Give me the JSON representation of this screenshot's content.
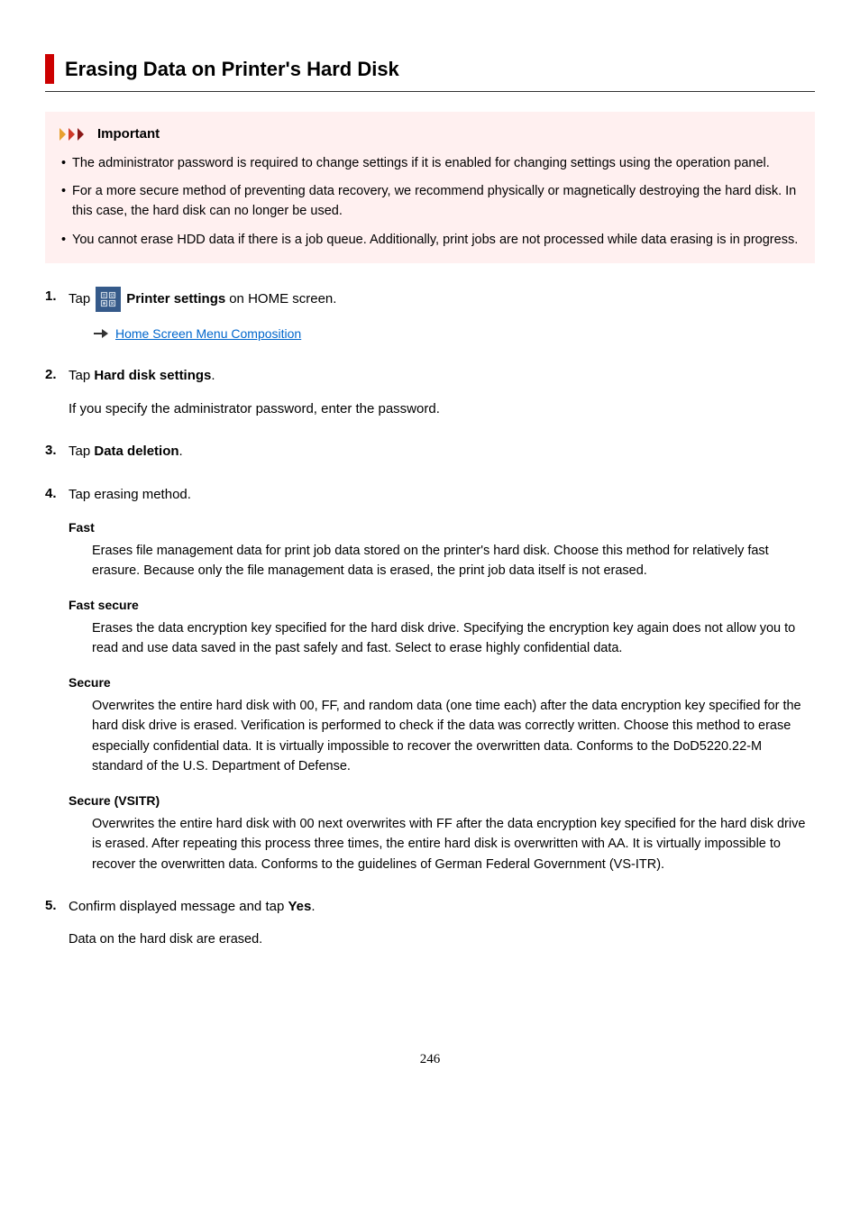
{
  "title": "Erasing Data on Printer's Hard Disk",
  "important": {
    "label": "Important",
    "items": [
      "The administrator password is required to change settings if it is enabled for changing settings using the operation panel.",
      "For a more secure method of preventing data recovery, we recommend physically or magnetically destroying the hard disk. In this case, the hard disk can no longer be used.",
      "You cannot erase HDD data if there is a job queue. Additionally, print jobs are not processed while data erasing is in progress."
    ]
  },
  "steps": {
    "s1": {
      "pre": "Tap",
      "bold": "Printer settings",
      "post": " on HOME screen.",
      "link_text": "Home Screen Menu Composition"
    },
    "s2": {
      "pre": "Tap ",
      "bold": "Hard disk settings",
      "post": ".",
      "note": "If you specify the administrator password, enter the password."
    },
    "s3": {
      "pre": "Tap ",
      "bold": "Data deletion",
      "post": "."
    },
    "s4": {
      "text": "Tap erasing method.",
      "methods": [
        {
          "name": "Fast",
          "desc": "Erases file management data for print job data stored on the printer's hard disk. Choose this method for relatively fast erasure. Because only the file management data is erased, the print job data itself is not erased."
        },
        {
          "name": "Fast secure",
          "desc": "Erases the data encryption key specified for the hard disk drive. Specifying the encryption key again does not allow you to read and use data saved in the past safely and fast. Select to erase highly confidential data."
        },
        {
          "name": "Secure",
          "desc": "Overwrites the entire hard disk with 00, FF, and random data (one time each) after the data encryption key specified for the hard disk drive is erased. Verification is performed to check if the data was correctly written. Choose this method to erase especially confidential data. It is virtually impossible to recover the overwritten data. Conforms to the DoD5220.22-M standard of the U.S. Department of Defense."
        },
        {
          "name": "Secure (VSITR)",
          "desc": "Overwrites the entire hard disk with 00 next overwrites with FF after the data encryption key specified for the hard disk drive is erased. After repeating this process three times, the entire hard disk is overwritten with AA. It is virtually impossible to recover the overwritten data. Conforms to the guidelines of German Federal Government (VS-ITR)."
        }
      ]
    },
    "s5": {
      "pre": "Confirm displayed message and tap ",
      "bold": "Yes",
      "post": ".",
      "result": "Data on the hard disk are erased."
    }
  },
  "page_number": "246"
}
